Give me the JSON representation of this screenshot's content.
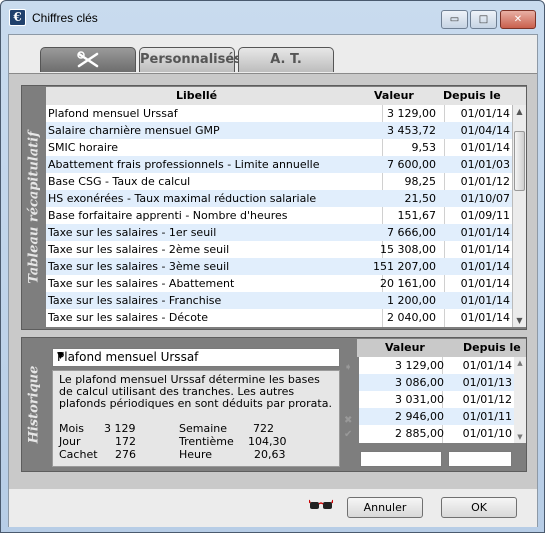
{
  "window": {
    "title": "Chiffres clés",
    "app_icon": "€",
    "min": "▭",
    "max": "□",
    "close": "✕"
  },
  "tabs": [
    {
      "label": "",
      "icon": "tools-icon"
    },
    {
      "label": "Personnalisés"
    },
    {
      "label": "A. T."
    }
  ],
  "summary": {
    "side_label": "Tableau récapitulatif",
    "headers": {
      "label": "Libellé",
      "value": "Valeur",
      "since": "Depuis le"
    },
    "rows": [
      {
        "label": "Plafond mensuel Urssaf",
        "value": "3 129,00",
        "since": "01/01/14"
      },
      {
        "label": "Salaire charnière mensuel GMP",
        "value": "3 453,72",
        "since": "01/04/14"
      },
      {
        "label": "SMIC horaire",
        "value": "9,53",
        "since": "01/01/14"
      },
      {
        "label": "Abattement frais professionnels - Limite annuelle",
        "value": "7 600,00",
        "since": "01/01/03"
      },
      {
        "label": "Base CSG - Taux de calcul",
        "value": "98,25",
        "since": "01/01/12"
      },
      {
        "label": "HS exonérées - Taux maximal réduction salariale",
        "value": "21,50",
        "since": "01/10/07"
      },
      {
        "label": "Base forfaitaire apprenti - Nombre d'heures",
        "value": "151,67",
        "since": "01/09/11"
      },
      {
        "label": "Taxe sur les salaires - 1er seuil",
        "value": "7 666,00",
        "since": "01/01/14"
      },
      {
        "label": "Taxe sur les salaires - 2ème seuil",
        "value": "15 308,00",
        "since": "01/01/14"
      },
      {
        "label": "Taxe sur les salaires - 3ème seuil",
        "value": "151 207,00",
        "since": "01/01/14"
      },
      {
        "label": "Taxe sur les salaires - Abattement",
        "value": "20 161,00",
        "since": "01/01/14"
      },
      {
        "label": "Taxe sur les salaires - Franchise",
        "value": "1 200,00",
        "since": "01/01/14"
      },
      {
        "label": "Taxe sur les salaires - Décote",
        "value": "2 040,00",
        "since": "01/01/14"
      }
    ]
  },
  "history": {
    "side_label": "Historique",
    "selected": "Plafond mensuel Urssaf",
    "description": "Le plafond mensuel Urssaf détermine les bases de calcul utilisant des tranches. Les autres plafonds périodiques en sont déduits par prorata.",
    "stats": {
      "mois_label": "Mois",
      "mois_value": "3 129",
      "semaine_label": "Semaine",
      "semaine_value": "722",
      "jour_label": "Jour",
      "jour_value": "172",
      "trentieme_label": "Trentième",
      "trentieme_value": "104,30",
      "cachet_label": "Cachet",
      "cachet_value": "276",
      "heure_label": "Heure",
      "heure_value": "20,63"
    },
    "headers": {
      "value": "Valeur",
      "since": "Depuis le"
    },
    "rows": [
      {
        "value": "3 129,00",
        "since": "01/01/14"
      },
      {
        "value": "3 086,00",
        "since": "01/01/13"
      },
      {
        "value": "3 031,00",
        "since": "01/01/12"
      },
      {
        "value": "2 946,00",
        "since": "01/01/11"
      },
      {
        "value": "2 885,00",
        "since": "01/01/10"
      }
    ],
    "new_value": "",
    "new_since": ""
  },
  "footer": {
    "cancel_label": "Annuler",
    "ok_label": "OK"
  }
}
